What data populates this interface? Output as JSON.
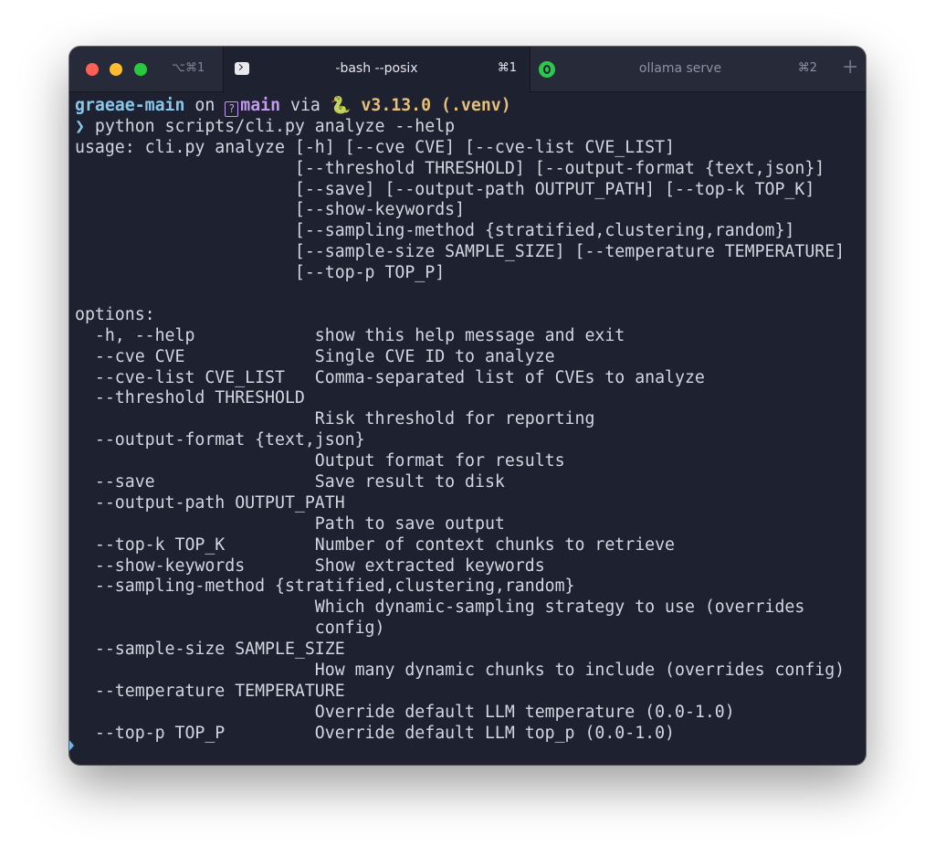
{
  "window": {
    "shortcut": "⌥⌘1",
    "tabs": [
      {
        "title": "-bash --posix",
        "shortcut": "⌘1",
        "icon": "terminal-icon",
        "active": true
      },
      {
        "title": "ollama serve",
        "shortcut": "⌘2",
        "icon": "ollama-icon",
        "active": false
      }
    ],
    "new_tab_label": "+"
  },
  "prompt": {
    "dir": "graeae-main",
    "on": " on ",
    "branch_icon": "?",
    "branch": "main",
    "via": " via ",
    "python_icon": "🐍",
    "version": " v3.13.0 (.venv)",
    "arrow": "❯",
    "command": " python scripts/cli.py analyze --help"
  },
  "output_lines": [
    "usage: cli.py analyze [-h] [--cve CVE] [--cve-list CVE_LIST]",
    "                      [--threshold THRESHOLD] [--output-format {text,json}]",
    "                      [--save] [--output-path OUTPUT_PATH] [--top-k TOP_K]",
    "                      [--show-keywords]",
    "                      [--sampling-method {stratified,clustering,random}]",
    "                      [--sample-size SAMPLE_SIZE] [--temperature TEMPERATURE]",
    "                      [--top-p TOP_P]",
    "",
    "options:",
    "  -h, --help            show this help message and exit",
    "  --cve CVE             Single CVE ID to analyze",
    "  --cve-list CVE_LIST   Comma-separated list of CVEs to analyze",
    "  --threshold THRESHOLD",
    "                        Risk threshold for reporting",
    "  --output-format {text,json}",
    "                        Output format for results",
    "  --save                Save result to disk",
    "  --output-path OUTPUT_PATH",
    "                        Path to save output",
    "  --top-k TOP_K         Number of context chunks to retrieve",
    "  --show-keywords       Show extracted keywords",
    "  --sampling-method {stratified,clustering,random}",
    "                        Which dynamic-sampling strategy to use (overrides",
    "                        config)",
    "  --sample-size SAMPLE_SIZE",
    "                        How many dynamic chunks to include (overrides config)",
    "  --temperature TEMPERATURE",
    "                        Override default LLM temperature (0.0-1.0)",
    "  --top-p TOP_P         Override default LLM top_p (0.0-1.0)"
  ],
  "colors": {
    "background": "#1e2130",
    "titlebar": "#272a39",
    "text": "#d4d6e0",
    "prompt_dir": "#89c8ec",
    "prompt_branch": "#c599f0",
    "prompt_version": "#e5c07b"
  }
}
